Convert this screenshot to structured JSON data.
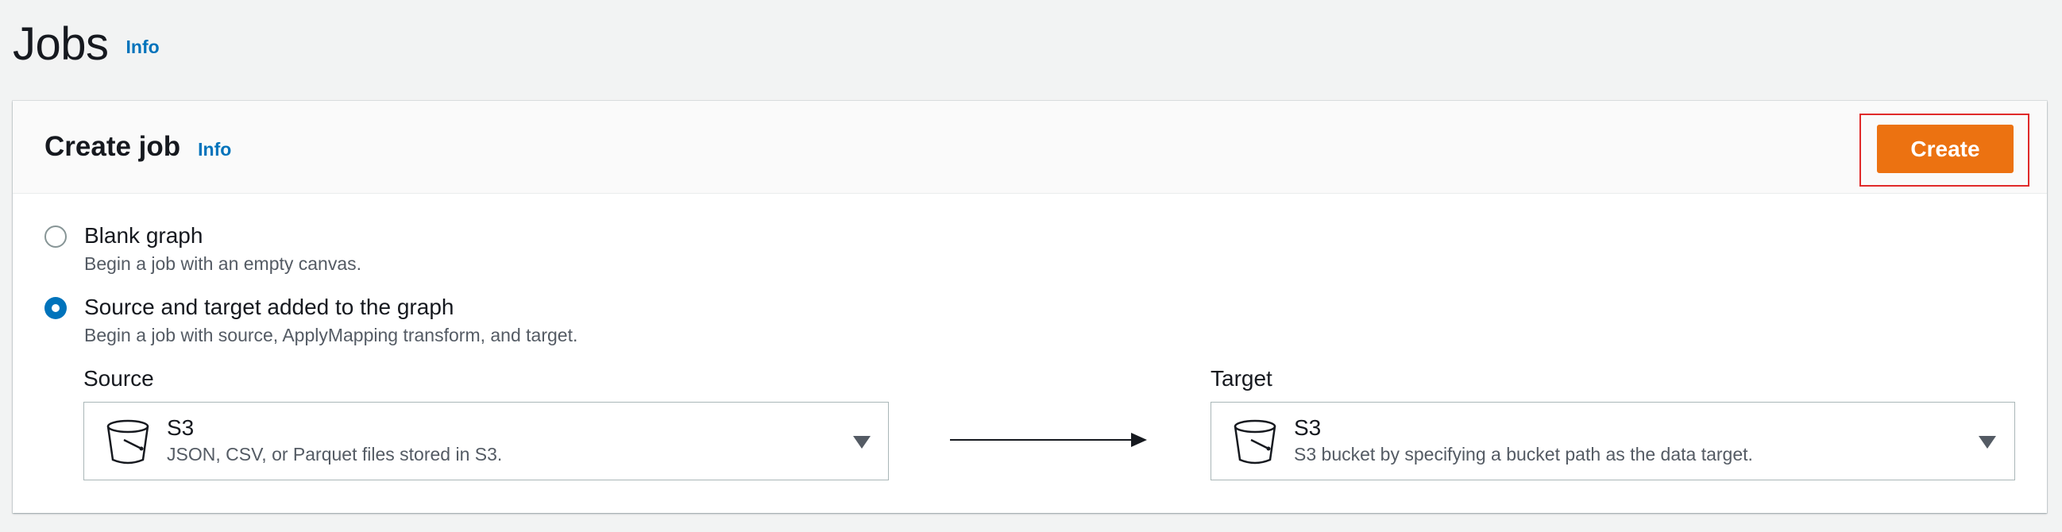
{
  "page": {
    "title": "Jobs",
    "info_link": "Info"
  },
  "panel": {
    "title": "Create job",
    "info_link": "Info",
    "create_button": "Create"
  },
  "options": [
    {
      "label": "Blank graph",
      "description": "Begin a job with an empty canvas.",
      "selected": false
    },
    {
      "label": "Source and target added to the graph",
      "description": "Begin a job with source, ApplyMapping transform, and target.",
      "selected": true
    }
  ],
  "source": {
    "label": "Source",
    "title": "S3",
    "description": "JSON, CSV, or Parquet files stored in S3.",
    "icon": "bucket-icon"
  },
  "target": {
    "label": "Target",
    "title": "S3",
    "description": "S3 bucket by specifying a bucket path as the data target.",
    "icon": "bucket-icon"
  },
  "colors": {
    "primary_button": "#ec7211",
    "link": "#0073bb",
    "highlight_border": "#e02a2a",
    "radio_selected": "#0073bb"
  }
}
